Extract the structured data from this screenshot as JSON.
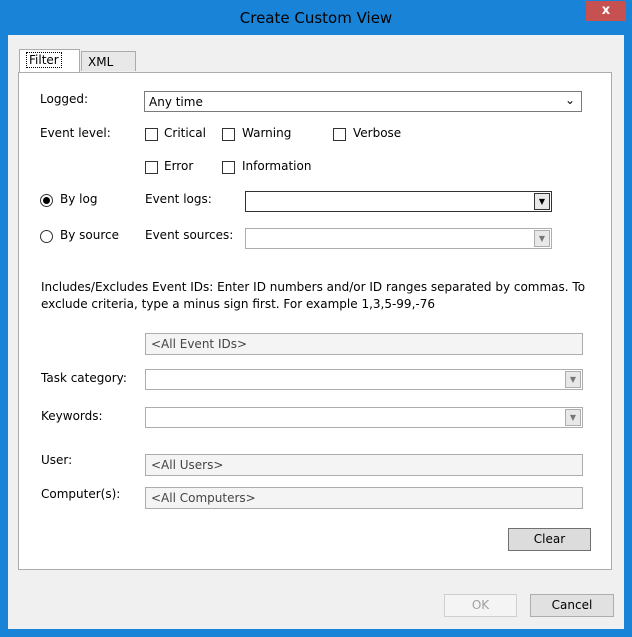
{
  "window": {
    "title": "Create Custom View",
    "close_label": "x"
  },
  "tabs": [
    {
      "label": "Filter"
    },
    {
      "label": "XML"
    }
  ],
  "filter": {
    "logged": {
      "label": "Logged:",
      "value": "Any time"
    },
    "event_level": {
      "label": "Event level:",
      "options": [
        {
          "label": "Critical",
          "checked": false
        },
        {
          "label": "Warning",
          "checked": false
        },
        {
          "label": "Verbose",
          "checked": false
        },
        {
          "label": "Error",
          "checked": false
        },
        {
          "label": "Information",
          "checked": false
        }
      ]
    },
    "by_log": {
      "label": "By log",
      "selected": true
    },
    "by_source": {
      "label": "By source",
      "selected": false
    },
    "event_logs": {
      "label": "Event logs:",
      "value": ""
    },
    "event_sources": {
      "label": "Event sources:",
      "value": ""
    },
    "description": "Includes/Excludes Event IDs: Enter ID numbers and/or ID ranges separated by commas. To exclude criteria, type a minus sign first. For example 1,3,5-99,-76",
    "event_ids": {
      "placeholder": "<All Event IDs>"
    },
    "task_category": {
      "label": "Task category:",
      "value": ""
    },
    "keywords": {
      "label": "Keywords:",
      "value": ""
    },
    "user": {
      "label": "User:",
      "placeholder": "<All Users>"
    },
    "computer": {
      "label": "Computer(s):",
      "placeholder": "<All Computers>"
    },
    "clear_label": "Clear"
  },
  "footer": {
    "ok_label": "OK",
    "cancel_label": "Cancel"
  }
}
